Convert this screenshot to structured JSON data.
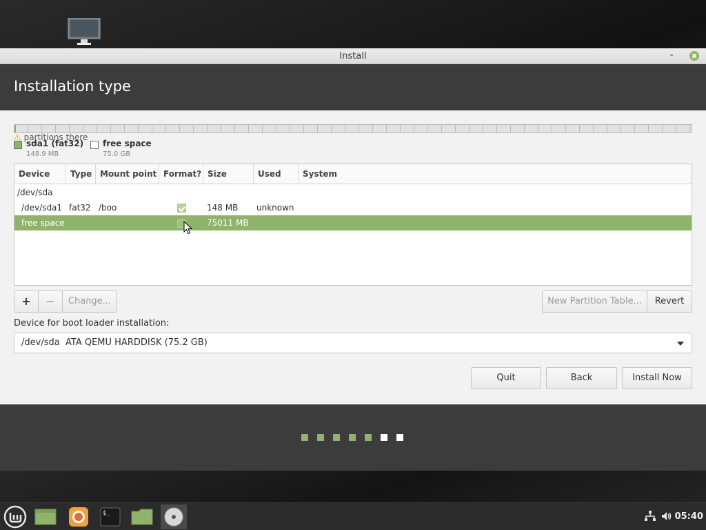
{
  "window": {
    "title": "Install",
    "minimize_glyph": "-",
    "close_icon": "close-icon"
  },
  "header": {
    "title": "Installation type"
  },
  "partition_bar": {
    "warning": "partitions there",
    "legend": [
      {
        "name": "sda1 (fat32)",
        "size": "148.9 MB",
        "color": "#8fb36a"
      },
      {
        "name": "free space",
        "size": "75.0 GB",
        "color": "#ffffff"
      }
    ]
  },
  "table": {
    "columns": [
      "Device",
      "Type",
      "Mount point",
      "Format?",
      "Size",
      "Used",
      "System"
    ],
    "rows": [
      {
        "device": "/dev/sda",
        "type": "",
        "mount": "",
        "format": null,
        "size": "",
        "used": "",
        "system": "",
        "selected": false
      },
      {
        "device": "/dev/sda1",
        "type": "fat32",
        "mount": "/boo",
        "format": true,
        "size": "148 MB",
        "used": "unknown",
        "system": "",
        "selected": false
      },
      {
        "device": "free space",
        "type": "",
        "mount": "",
        "format": false,
        "size": "75011 MB",
        "used": "",
        "system": "",
        "selected": true
      }
    ]
  },
  "toolbar": {
    "add_label": "+",
    "remove_label": "−",
    "change_label": "Change...",
    "new_table_label": "New Partition Table...",
    "revert_label": "Revert"
  },
  "bootloader": {
    "label": "Device for boot loader installation:",
    "device": "/dev/sda",
    "description": "ATA QEMU HARDDISK (75.2 GB)"
  },
  "actions": {
    "quit_label": "Quit",
    "back_label": "Back",
    "install_label": "Install Now"
  },
  "progress": {
    "total_steps": 7,
    "completed_steps": 5
  },
  "taskbar": {
    "clock": "05:40",
    "items": [
      "mint-menu-icon",
      "show-desktop-icon",
      "firefox-icon",
      "terminal-icon",
      "files-icon",
      "installer-disc-icon"
    ],
    "tray": [
      "network-icon",
      "volume-icon"
    ]
  },
  "colors": {
    "accent": "#8fb36a",
    "header": "#3c3c3c"
  }
}
